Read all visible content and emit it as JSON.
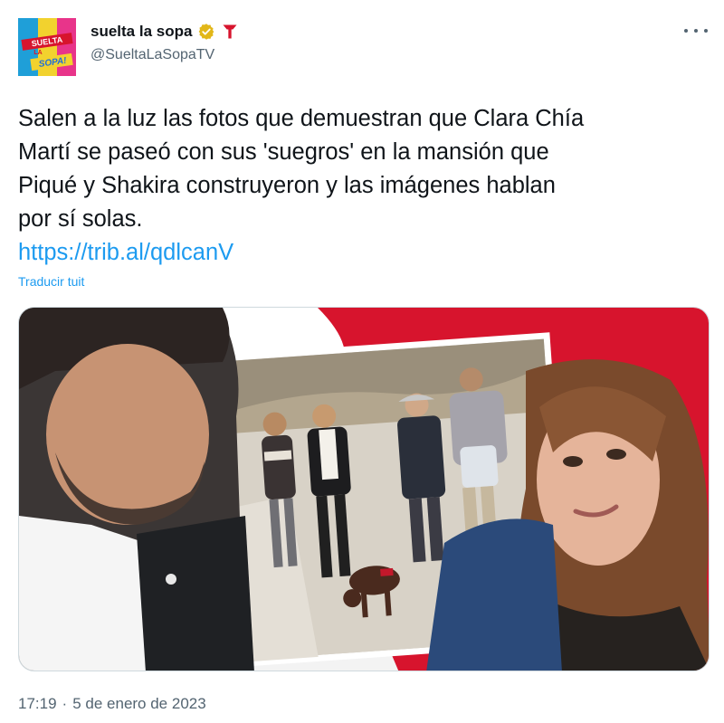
{
  "author": {
    "display_name": "suelta la sopa",
    "handle": "@SueltaLaSopaTV",
    "avatar_text": [
      "SUELTA",
      "LA",
      "SOPA!"
    ]
  },
  "tweet": {
    "lines": [
      "Salen a la luz las fotos que demuestran que Clara Chía",
      "Martí se paseó con sus 'suegros' en la mansión que",
      "Piqué y Shakira construyeron y las imágenes hablan",
      "por sí solas."
    ],
    "link": "https://trib.al/qdlcanV",
    "translate_label": "Traducir tuit"
  },
  "meta": {
    "time": "17:19",
    "separator": "·",
    "date": "5 de enero de 2023"
  },
  "colors": {
    "link": "#1d9bf0",
    "secondary_text": "#536471",
    "verified_badge": "#e2b719",
    "brand_red": "#d7142d"
  },
  "icons": {
    "verified": "verified-badge-icon",
    "network_logo": "telemundo-logo-icon",
    "more": "more-options-icon"
  }
}
